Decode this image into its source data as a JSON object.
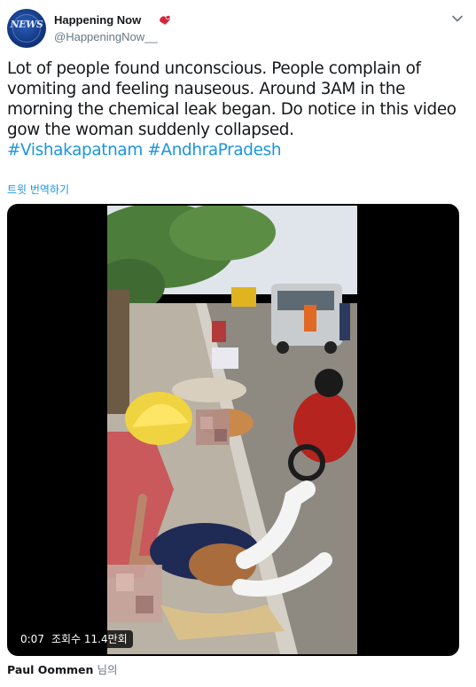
{
  "author": {
    "display_name": "Happening Now",
    "handle": "@HappeningNow__",
    "avatar_text": "NEWS",
    "verified_icon": "bird-badge-icon"
  },
  "tweet": {
    "text_plain": "Lot of people found unconscious. People complain of vomiting and feeling nauseous. Around 3AM in the morning the chemical leak began. Do notice in this video gow the woman suddenly collapsed.",
    "hashtags": [
      "#Vishakapatnam",
      "#AndhraPradesh"
    ],
    "translate_label": "트윗 번역하기"
  },
  "video": {
    "duration": "0:07",
    "views": "조회수 11.4만회"
  },
  "footer": {
    "name": "Paul Oommen",
    "suffix": "님의"
  },
  "colors": {
    "link": "#1b95e0",
    "text": "#14171a",
    "secondary": "#657786",
    "video_bg": "#000000"
  }
}
